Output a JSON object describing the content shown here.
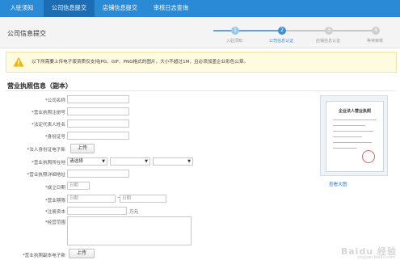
{
  "nav": {
    "tabs": [
      "入驻须知",
      "公司信息提交",
      "店铺信息提交",
      "审核日志查询"
    ],
    "active_index": 1
  },
  "header": {
    "title": "公司信息提交",
    "steps": [
      "入驻须知",
      "公司信息认证",
      "店铺信息认证",
      "等待审核"
    ],
    "step_numbers": [
      "1",
      "2",
      "3",
      "4"
    ],
    "current_step": 2
  },
  "notice": {
    "text": "以下所需要上传电子版资质仅支持JPG、GIF、PNG格式的图片，大小不超过1M，且必须加盖企业彩色公章。"
  },
  "section": {
    "title": "营业执照信息（副本）"
  },
  "form": {
    "company_name_label": "*公司名称",
    "license_no_label": "*营业执照注册号",
    "legal_rep_label": "*法定代表人姓名",
    "id_no_label": "*身份证号",
    "id_upload_label": "*法人身份证电子新",
    "upload_button": "上传",
    "license_location_label": "*营业执照所在地",
    "region_select_value": "请选择",
    "license_address_label": "*营业执照详细地址",
    "established_label": "*成立日期",
    "established_placeholder": "日期",
    "term_label": "*营业期限",
    "term_start_placeholder": "日期",
    "term_separator": "—",
    "term_end_placeholder": "日期",
    "capital_label": "*注册资本",
    "capital_unit": "万元",
    "scope_label": "*经营范围",
    "license_upload_label": "*营业执照副本电子新",
    "license_upload_button": "上传"
  },
  "sample": {
    "certificate_title": "企业法人营业执照",
    "zoom_link": "查看大图"
  },
  "watermark": {
    "text": "Baidu 经验",
    "url": "jingyan.baidu.com"
  },
  "colors": {
    "nav_bg": "#2b8ad6",
    "nav_active": "#1c6eb4",
    "step_active": "#3d8fd6",
    "notice_bg": "#fffbe0",
    "link": "#2b7bd6"
  }
}
